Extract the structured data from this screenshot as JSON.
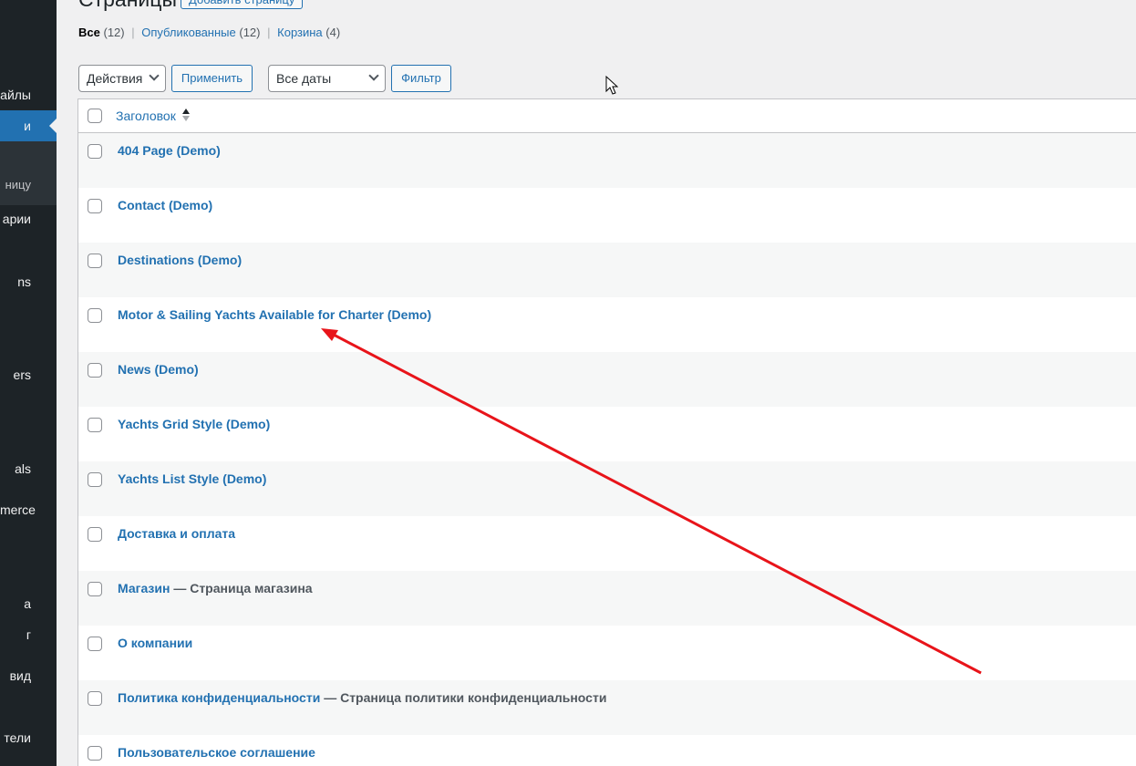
{
  "sidebar": {
    "items": [
      {
        "label": "айлы"
      },
      {
        "label": "и"
      },
      {
        "label": "ницу"
      },
      {
        "label": "арии"
      },
      {
        "label": "ns"
      },
      {
        "label": "ers"
      },
      {
        "label": "als"
      },
      {
        "label": "merce"
      },
      {
        "label": "а"
      },
      {
        "label": "г"
      },
      {
        "label": "вид"
      },
      {
        "label": "тели"
      }
    ]
  },
  "header": {
    "title": "Страницы",
    "add_new_label": "Добавить страницу"
  },
  "views": {
    "all_label": "Все",
    "all_count": "(12)",
    "published_label": "Опубликованные",
    "published_count": "(12)",
    "trash_label": "Корзина",
    "trash_count": "(4)",
    "separator": "|"
  },
  "tablenav": {
    "bulk_actions": "Действия",
    "apply_label": "Применить",
    "dates": "Все даты",
    "filter_label": "Фильтр"
  },
  "table": {
    "column_title": "Заголовок",
    "rows": [
      {
        "title": "404 Page (Demo)",
        "state": ""
      },
      {
        "title": "Contact (Demo)",
        "state": ""
      },
      {
        "title": "Destinations (Demo)",
        "state": ""
      },
      {
        "title": "Motor & Sailing Yachts Available for Charter (Demo)",
        "state": ""
      },
      {
        "title": "News (Demo)",
        "state": ""
      },
      {
        "title": "Yachts Grid Style (Demo)",
        "state": ""
      },
      {
        "title": "Yachts List Style (Demo)",
        "state": ""
      },
      {
        "title": "Доставка и оплата",
        "state": ""
      },
      {
        "title": "Магазин",
        "state": " — Страница магазина"
      },
      {
        "title": "О компании",
        "state": ""
      },
      {
        "title": "Политика конфиденциальности",
        "state": " — Страница политики конфиденциальности"
      },
      {
        "title": "Пользовательское соглашение",
        "state": ""
      }
    ]
  },
  "colors": {
    "sidebar_bg": "#1d2327",
    "accent": "#2271b1",
    "annotation_arrow": "#e8141a"
  },
  "icons": {
    "cursor": "mouse-pointer-icon",
    "annotation": "red-arrow-icon"
  }
}
